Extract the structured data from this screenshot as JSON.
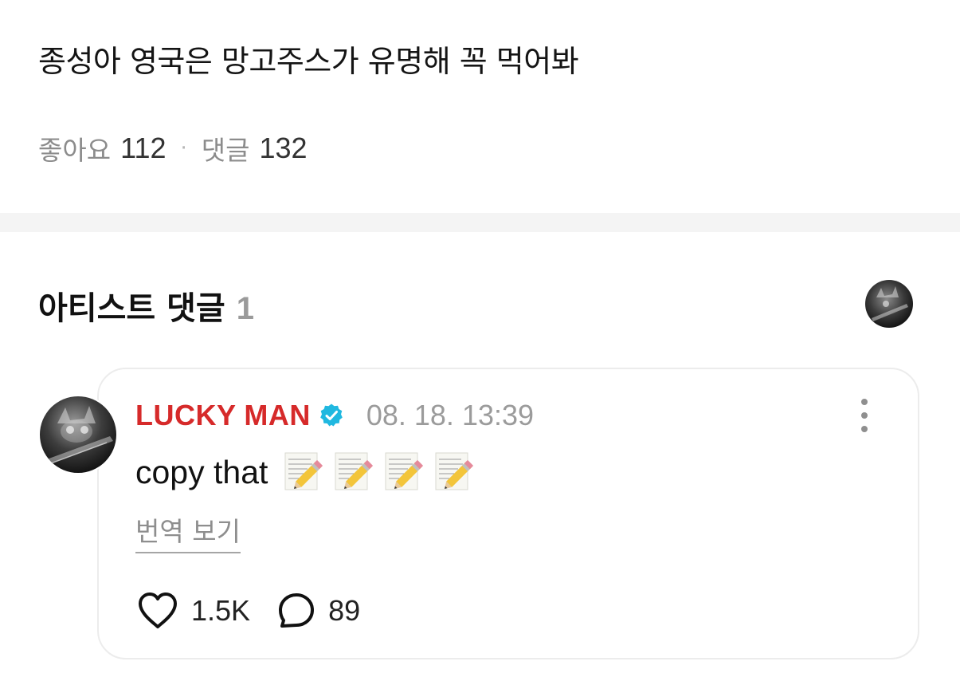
{
  "post": {
    "text": "종성아 영국은 망고주스가 유명해 꼭 먹어봐",
    "likes_label": "좋아요",
    "likes_count": "112",
    "separator": "·",
    "comments_label": "댓글",
    "comments_count": "132"
  },
  "artist_comments": {
    "title": "아티스트 댓글",
    "count": "1"
  },
  "comment": {
    "author": "LUCKY MAN",
    "verified_icon": "verified-badge-icon",
    "date": "08. 18. 13:39",
    "text": "copy that",
    "emojis": [
      "memo-icon",
      "memo-icon",
      "memo-icon",
      "memo-icon"
    ],
    "translate_label": "번역 보기",
    "like_count": "1.5K",
    "reply_count": "89"
  },
  "colors": {
    "author_red": "#d62a2a",
    "verified_blue": "#20b8e0",
    "muted_gray": "#8e8e8e",
    "divider": "#f4f4f4"
  }
}
